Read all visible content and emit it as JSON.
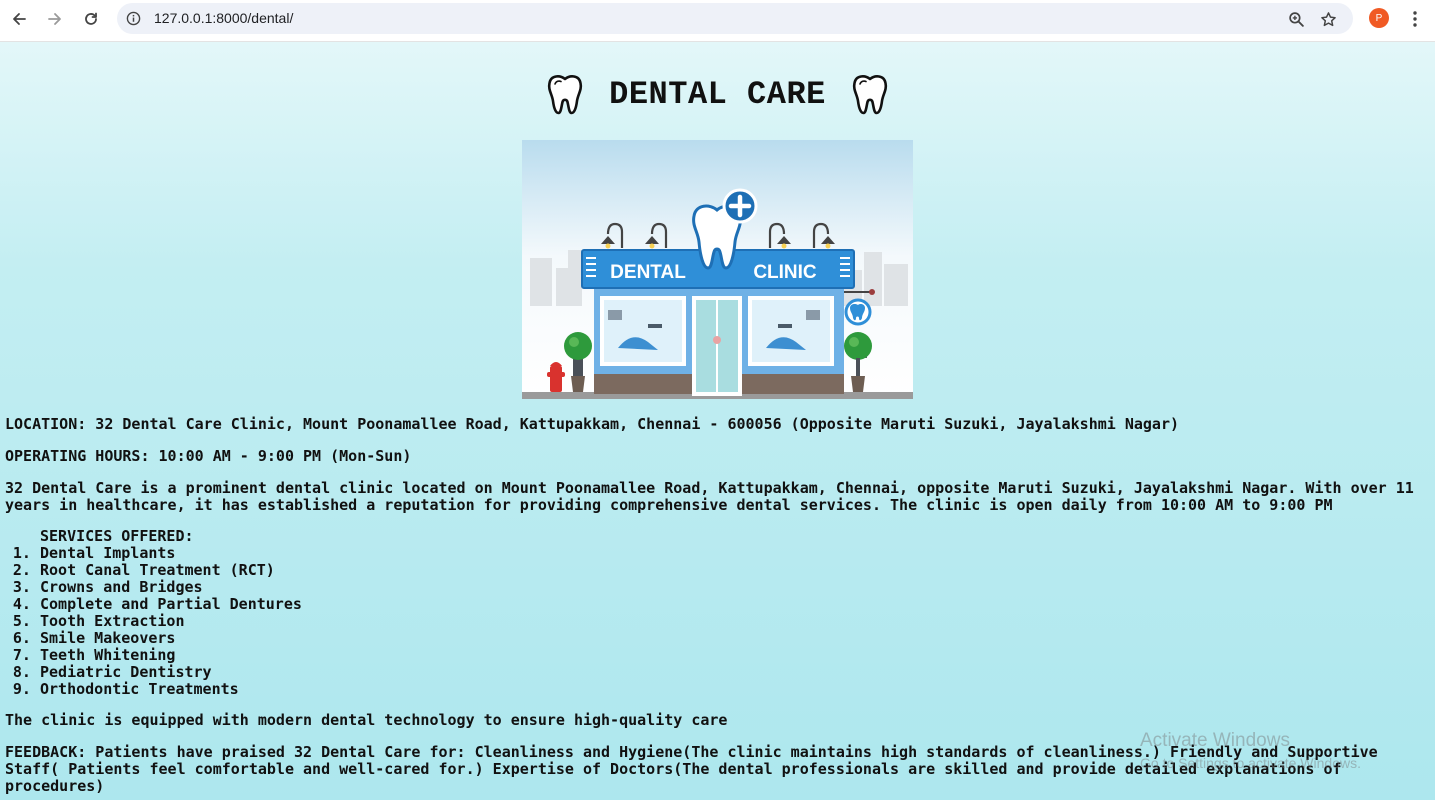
{
  "browser": {
    "url": "127.0.0.1:8000/dental/",
    "profile_initial": "P"
  },
  "page": {
    "title": "DENTAL CARE",
    "image": {
      "sign_left": "DENTAL",
      "sign_right": "CLINIC"
    },
    "location": "LOCATION: 32 Dental Care Clinic, Mount Poonamallee Road, Kattupakkam, Chennai - 600056 (Opposite Maruti Suzuki, Jayalakshmi Nagar)",
    "hours": "OPERATING HOURS: 10:00 AM - 9:00 PM (Mon-Sun)",
    "description": "32 Dental Care is a prominent dental clinic located on Mount Poonamallee Road, Kattupakkam, Chennai, opposite Maruti Suzuki, Jayalakshmi Nagar. With over 11 years in healthcare, it has established a reputation for providing comprehensive dental services. The clinic is open daily from 10:00 AM to 9:00 PM",
    "services_title": "SERVICES OFFERED:",
    "services": [
      "Dental Implants",
      "Root Canal Treatment (RCT)",
      "Crowns and Bridges",
      "Complete and Partial Dentures",
      "Tooth Extraction",
      "Smile Makeovers",
      "Teeth Whitening",
      "Pediatric Dentistry",
      "Orthodontic Treatments"
    ],
    "equipment": "The clinic is equipped with modern dental technology to ensure high-quality care",
    "feedback": "FEEDBACK: Patients have praised 32 Dental Care for: Cleanliness and Hygiene(The clinic maintains high standards of cleanliness.) Friendly and Supportive Staff( Patients feel comfortable and well-cared for.) Expertise of Doctors(The dental professionals are skilled and provide detailed explanations of procedures)"
  },
  "watermark": {
    "line1": "Activate Windows",
    "line2": "Go to Settings to activate Windows."
  },
  "colors": {
    "page_gradient_top": "#e3f7f9",
    "page_gradient_bottom": "#ade7ee",
    "profile": "#f05a24",
    "clinic_blue": "#2f8fd8"
  },
  "icons": [
    "back-icon",
    "forward-icon",
    "reload-icon",
    "info-icon",
    "zoom-icon",
    "star-icon",
    "kebab-menu-icon",
    "tooth-icon"
  ]
}
